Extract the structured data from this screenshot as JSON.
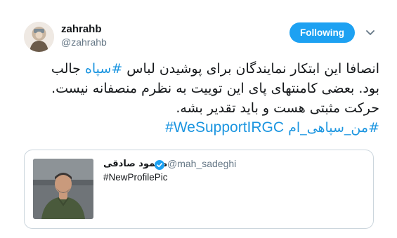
{
  "tweet": {
    "author": {
      "display_name": "zahrahb",
      "handle": "@zahrahb"
    },
    "follow_button_label": "Following",
    "text_lines": [
      {
        "before": "انصافا این ابتکار نمایندگان برای پوشیدن لباس ",
        "hashtag": "#سپاه",
        "after": " جالب"
      },
      {
        "text": "بود. بعضی کامنتهای پای این توییت به نظرم منصفانه نیست."
      },
      {
        "text": "حرکت مثبتی هست و باید تقدیر بشه."
      }
    ],
    "hashtag_line": {
      "fa_hashtag": "#من_سپاهی_ام",
      "en_hashtag": "#WeSupportIRGC"
    }
  },
  "quoted_tweet": {
    "display_name": "محمود صادقی",
    "handle": "@mah_sadeghi",
    "text": "#NewProfilePic"
  },
  "colors": {
    "accent": "#1da1f2",
    "hashtag": "#1b95e0",
    "text": "#14171a",
    "muted": "#657786",
    "border": "#ccd6dd"
  },
  "icons": {
    "caret": "chevron-down-icon",
    "verified": "verified-badge-icon"
  }
}
